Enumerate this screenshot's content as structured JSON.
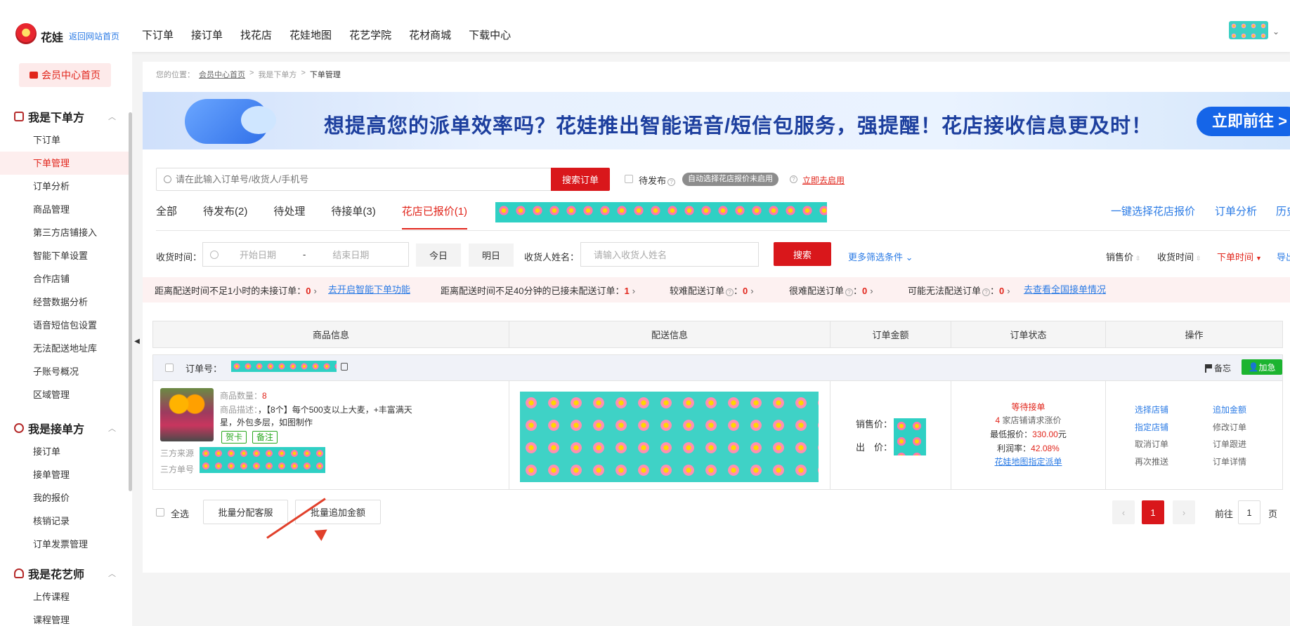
{
  "header": {
    "brand": "花娃",
    "back_link": "返回网站首页",
    "nav": [
      "下订单",
      "接订单",
      "找花店",
      "花娃地图",
      "花艺学院",
      "花材商城",
      "下载中心"
    ]
  },
  "sidebar": {
    "member_home": "会员中心首页",
    "sections": [
      {
        "title": "我是下单方",
        "items": [
          "下订单",
          "下单管理",
          "订单分析",
          "商品管理",
          "第三方店铺接入",
          "智能下单设置",
          "合作店铺",
          "经营数据分析",
          "语音短信包设置",
          "无法配送地址库",
          "子账号概况",
          "区域管理"
        ]
      },
      {
        "title": "我是接单方",
        "items": [
          "接订单",
          "接单管理",
          "我的报价",
          "核销记录",
          "订单发票管理"
        ]
      },
      {
        "title": "我是花艺师",
        "items": [
          "上传课程",
          "课程管理"
        ]
      }
    ],
    "active_item": "下单管理"
  },
  "breadcrumb": {
    "prefix": "您的位置：",
    "items": [
      "会员中心首页",
      "我是下单方",
      "下单管理"
    ],
    "sep": ">"
  },
  "banner": {
    "text": "想提高您的派单效率吗？花娃推出智能语音/短信包服务，强提醒！花店接收信息更及时！",
    "button": "立即前往 >"
  },
  "search": {
    "placeholder": "请在此输入订单号/收货人/手机号",
    "button": "搜索订单",
    "pending_label": "待发布",
    "auto_badge": "自动选择花店报价未启用",
    "enable_link": "立即去启用"
  },
  "tabs": {
    "items": [
      "全部",
      "待发布(2)",
      "待处理",
      "待接单(3)",
      "花店已报价(1)"
    ],
    "active": "花店已报价(1)",
    "right": [
      "一键选择花店报价",
      "订单分析",
      "历史"
    ]
  },
  "filters": {
    "receive_time_label": "收货时间：",
    "start_placeholder": "开始日期",
    "range_sep": "-",
    "end_placeholder": "结束日期",
    "today": "今日",
    "tomorrow": "明日",
    "receiver_label": "收货人姓名：",
    "receiver_placeholder": "请输入收货人姓名",
    "search_button": "搜索",
    "more": "更多筛选条件",
    "sorts": [
      "销售价",
      "收货时间",
      "下单时间",
      "导出"
    ],
    "active_sort": "下单时间"
  },
  "alerts": [
    {
      "label": "距离配送时间不足1小时的未接订单：",
      "count": "0"
    },
    {
      "label": "距离配送时间不足40分钟的已接未配送订单：",
      "count": "1"
    },
    {
      "label": "较难配送订单",
      "count": "0"
    },
    {
      "label": "很难配送订单",
      "count": "0"
    },
    {
      "label": "可能无法配送订单",
      "count": "0"
    }
  ],
  "alert_links": [
    "去开启智能下单功能",
    "去查看全国接单情况"
  ],
  "table": {
    "headers": [
      "商品信息",
      "配送信息",
      "订单金额",
      "订单状态",
      "操作"
    ],
    "order": {
      "order_no_label": "订单号：",
      "memo": "备忘",
      "urgent": "加急",
      "product": {
        "qty_label": "商品数量：",
        "qty": "8",
        "desc_label": "商品描述：",
        "desc": "，【8个】每个500支以上大麦，+丰富满天星，外包多层，如图制作",
        "tags": [
          "贺卡",
          "备注"
        ],
        "source_label": "三方来源",
        "source_no_label": "三方单号"
      },
      "amount": {
        "sale_label": "销售价：",
        "out_label": "出　价："
      },
      "status": {
        "state": "等待接单",
        "count": "4",
        "count_text": "家店铺请求涨价",
        "min_label": "最低报价：",
        "min_value": "330.00",
        "min_unit": "元",
        "margin_label": "利润率：",
        "margin_value": "42.08%",
        "map_link": "花娃地图指定派单"
      },
      "ops": {
        "left": [
          "选择店铺",
          "指定店铺",
          "取消订单",
          "再次推送"
        ],
        "right": [
          "追加金额",
          "修改订单",
          "订单跟进",
          "订单详情"
        ]
      }
    }
  },
  "footer": {
    "select_all": "全选",
    "bulk_assign": "批量分配客服",
    "bulk_add": "批量追加金额",
    "page": "1",
    "goto_label": "前往",
    "goto_value": "1",
    "page_unit": "页"
  },
  "colors": {
    "accent": "#d9171b",
    "link": "#2b7be5",
    "tag_green": "#29a81f",
    "urgent_green": "#1cb430",
    "annotation_arrow": "#e1402b"
  }
}
